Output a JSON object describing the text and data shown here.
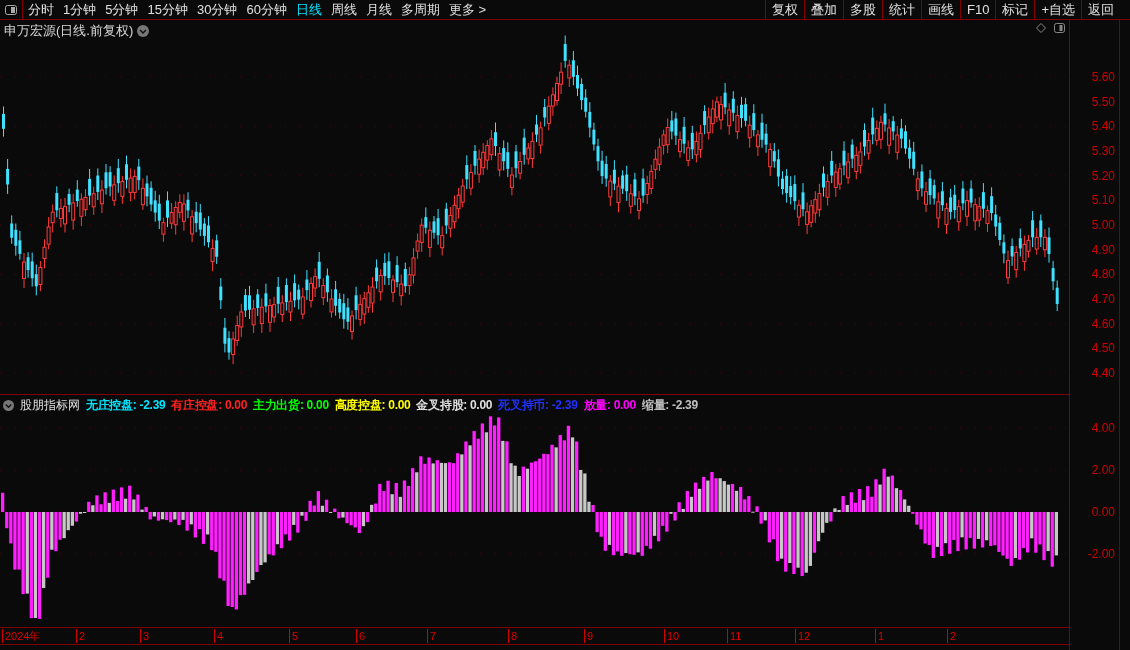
{
  "toolbar": {
    "periods": [
      {
        "label": "分时",
        "selected": false
      },
      {
        "label": "1分钟",
        "selected": false
      },
      {
        "label": "5分钟",
        "selected": false
      },
      {
        "label": "15分钟",
        "selected": false
      },
      {
        "label": "30分钟",
        "selected": false
      },
      {
        "label": "60分钟",
        "selected": false
      },
      {
        "label": "日线",
        "selected": true
      },
      {
        "label": "周线",
        "selected": false
      },
      {
        "label": "月线",
        "selected": false
      },
      {
        "label": "多周期",
        "selected": false
      },
      {
        "label": "更多 >",
        "selected": false
      }
    ],
    "buttons": [
      "复权",
      "叠加",
      "多股",
      "统计",
      "画线",
      "F10",
      "标记",
      "+自选",
      "返回"
    ]
  },
  "chart_title": "申万宏源(日线.前复权)",
  "price_axis": [
    "5.60",
    "5.50",
    "5.40",
    "5.30",
    "5.20",
    "5.10",
    "5.00",
    "4.90",
    "4.80",
    "4.70",
    "4.60",
    "4.50",
    "4.40"
  ],
  "indicator": {
    "name": "股朋指标网",
    "legend": [
      {
        "label": "无庄控盘:",
        "value": "-2.39",
        "color": "#00e5ff"
      },
      {
        "label": "有庄控盘:",
        "value": "0.00",
        "color": "#ff2020"
      },
      {
        "label": "主力出货:",
        "value": "0.00",
        "color": "#00ff00"
      },
      {
        "label": "高度控盘:",
        "value": "0.00",
        "color": "#ffff00"
      },
      {
        "label": "金叉持股:",
        "value": "0.00",
        "color": "#e0e0e0"
      },
      {
        "label": "死叉持币:",
        "value": "-2.39",
        "color": "#2030ff"
      },
      {
        "label": "放量:",
        "value": "0.00",
        "color": "#ff00ff"
      },
      {
        "label": "缩量:",
        "value": "-2.39",
        "color": "#c0c0c0"
      }
    ],
    "axis": [
      "4.00",
      "2.00",
      "0.00",
      "-2.00"
    ]
  },
  "date_axis": [
    "2024年",
    "2",
    "3",
    "4",
    "5",
    "6",
    "7",
    "8",
    "9",
    "10",
    "11",
    "12",
    "1",
    "2"
  ]
}
